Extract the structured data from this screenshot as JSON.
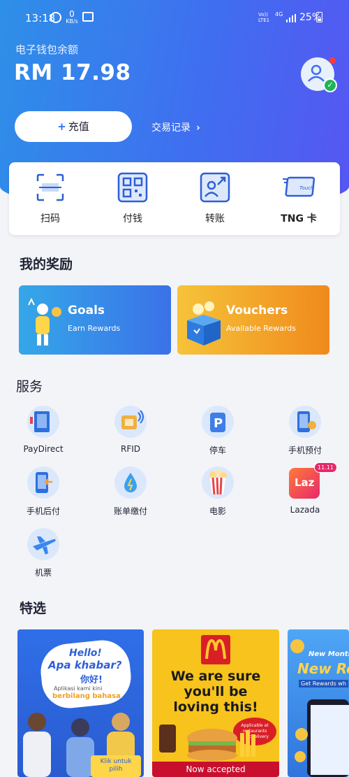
{
  "status": {
    "time": "13:18",
    "kb": "0",
    "kb_unit": "KB/s",
    "volte1": "Vo))",
    "volte2": "LTE1",
    "net": "4G",
    "battery": "25%"
  },
  "wallet": {
    "label": "电子钱包余额",
    "balance": "RM 17.98"
  },
  "topup": {
    "plus": "+",
    "label": "充值"
  },
  "history": {
    "label": "交易记录",
    "chevron": "›"
  },
  "actions": [
    {
      "label": "扫码",
      "icon": "scan-icon"
    },
    {
      "label": "付钱",
      "icon": "qr-pay-icon"
    },
    {
      "label": "转账",
      "icon": "transfer-icon"
    },
    {
      "label": "TNG 卡",
      "icon": "tng-card-icon"
    }
  ],
  "rewards": {
    "title": "我的奖励",
    "goals": {
      "title": "Goals",
      "subtitle": "Earn Rewards"
    },
    "vouchers": {
      "title": "Vouchers",
      "subtitle": "Available Rewards"
    }
  },
  "services": {
    "title": "服务",
    "items": [
      {
        "label": "PayDirect",
        "icon": "paydirect-icon"
      },
      {
        "label": "RFID",
        "icon": "rfid-icon"
      },
      {
        "label": "停车",
        "icon": "parking-icon"
      },
      {
        "label": "手机预付",
        "icon": "prepaid-icon"
      },
      {
        "label": "手机后付",
        "icon": "postpaid-icon"
      },
      {
        "label": "账单缴付",
        "icon": "bill-icon"
      },
      {
        "label": "电影",
        "icon": "movie-icon"
      },
      {
        "label": "Lazada",
        "icon": "lazada-icon",
        "badge": "11.11",
        "logo": "Laz"
      },
      {
        "label": "机票",
        "icon": "flight-icon"
      }
    ]
  },
  "featured": {
    "title": "特选",
    "promo1": {
      "line1": "Hello!",
      "line2": "Apa khabar?",
      "line3": "你好!",
      "line4": "Aplikasi kami kini",
      "line5": "berbilang bahasa.",
      "cta": "Klik untuk",
      "cta2": "pilih"
    },
    "promo2": {
      "headline1": "We are sure",
      "headline2": "you'll be",
      "headline3": "loving this!",
      "tag1": "Applicable at",
      "tag2": "restaurants",
      "tag3": "& McDelivery",
      "footer": "Now accepted"
    },
    "promo3": {
      "line1": "New Month",
      "line2": "New Re",
      "line3": "Get Rewards wh"
    }
  },
  "colors": {
    "primary": "#3f6ff0",
    "accent_green": "#22b35a",
    "badge_red": "#ff3b3b"
  }
}
